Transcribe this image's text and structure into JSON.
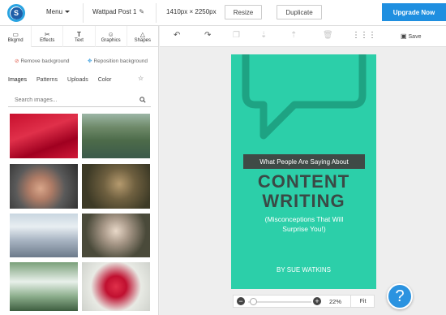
{
  "header": {
    "logo_letter": "S",
    "menu_label": "Menu",
    "doc_title": "Wattpad Post 1",
    "dimensions": "1410px × 2250px",
    "resize_label": "Resize",
    "duplicate_label": "Duplicate",
    "upgrade_label": "Upgrade Now"
  },
  "left_panel": {
    "tabs": [
      {
        "label": "Bkgrnd",
        "icon": "image-icon"
      },
      {
        "label": "Effects",
        "icon": "effects-icon"
      },
      {
        "label": "Text",
        "icon": "text-icon"
      },
      {
        "label": "Graphics",
        "icon": "graphics-icon"
      },
      {
        "label": "Shapes",
        "icon": "shapes-icon"
      }
    ],
    "remove_background": "Remove background",
    "reposition_background": "Reposition background",
    "subtabs": [
      "Images",
      "Patterns",
      "Uploads",
      "Color"
    ],
    "search_placeholder": "Search images..."
  },
  "toolbar": {
    "save_label": "Save"
  },
  "poster": {
    "banner": "What People Are Saying About",
    "title_line1": "CONTENT",
    "title_line2": "WRITING",
    "subtitle_line1": "(Misconceptions That Will",
    "subtitle_line2": "Surprise You!)",
    "author": "BY SUE WATKINS",
    "background_color": "#2ccfa9"
  },
  "zoom": {
    "value": "22%",
    "fit_label": "Fit"
  },
  "help": {
    "symbol": "?"
  },
  "colors": {
    "accent": "#1f8fe0",
    "poster_green": "#2ccfa9",
    "poster_dark": "#3a4945"
  }
}
